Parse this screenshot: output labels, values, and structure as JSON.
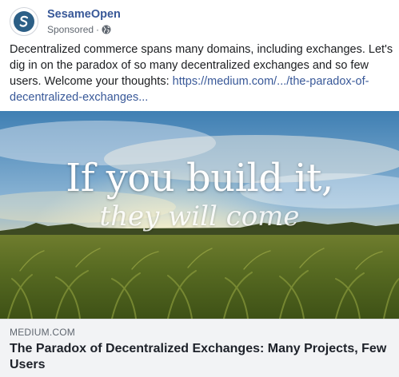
{
  "post": {
    "page_name": "SesameOpen",
    "sponsored_label": "Sponsored",
    "separator": "·",
    "privacy_icon": "globe-icon",
    "avatar_icon": "sesameopen-logo-icon",
    "body": {
      "text": "Decentralized commerce spans many domains, including exchanges. Let's dig in on the paradox of so many decentralized exchanges and so few users. Welcome your thoughts: ",
      "link_text": "https://medium.com/.../the-paradox-of-decentralized-exchanges..."
    },
    "image": {
      "headline": "If you build it,",
      "subheadline": "they will come"
    },
    "link_preview": {
      "domain": "MEDIUM.COM",
      "title": "The Paradox of Decentralized Exchanges: Many Projects, Few Users"
    },
    "colors": {
      "link_blue": "#385898",
      "meta_gray": "#606770",
      "footer_bg": "#f2f3f5",
      "avatar_blue": "#2c5f86"
    }
  }
}
